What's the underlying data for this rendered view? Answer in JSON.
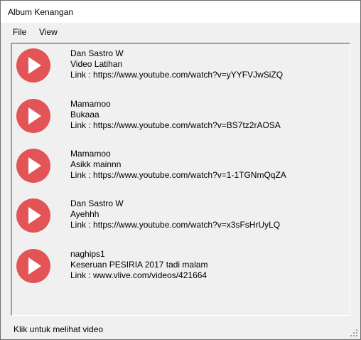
{
  "window": {
    "title": "Album Kenangan"
  },
  "menu": {
    "file": "File",
    "view": "View"
  },
  "videos": [
    {
      "author": "Dan Sastro W",
      "title": "Video Latihan",
      "link": "Link : https://www.youtube.com/watch?v=yYYFVJwSiZQ"
    },
    {
      "author": "Mamamoo",
      "title": "Bukaaa",
      "link": "Link : https://www.youtube.com/watch?v=BS7tz2rAOSA"
    },
    {
      "author": "Mamamoo",
      "title": "Asikk mainnn",
      "link": "Link : https://www.youtube.com/watch?v=1-1TGNmQqZA"
    },
    {
      "author": "Dan Sastro W",
      "title": "Ayehhh",
      "link": "Link : https://www.youtube.com/watch?v=x3sFsHrUyLQ"
    },
    {
      "author": "naghips1",
      "title": "Keseruan PESIRIA 2017 tadi malam",
      "link": "Link : www.vlive.com/videos/421664"
    }
  ],
  "status": {
    "text": "Klik untuk melihat video"
  },
  "colors": {
    "play_button": "#e25456",
    "play_icon": "#ffffff",
    "background": "#f0f0f0"
  },
  "icons": {
    "play": "play-icon",
    "resize": "resize-grip-icon"
  }
}
